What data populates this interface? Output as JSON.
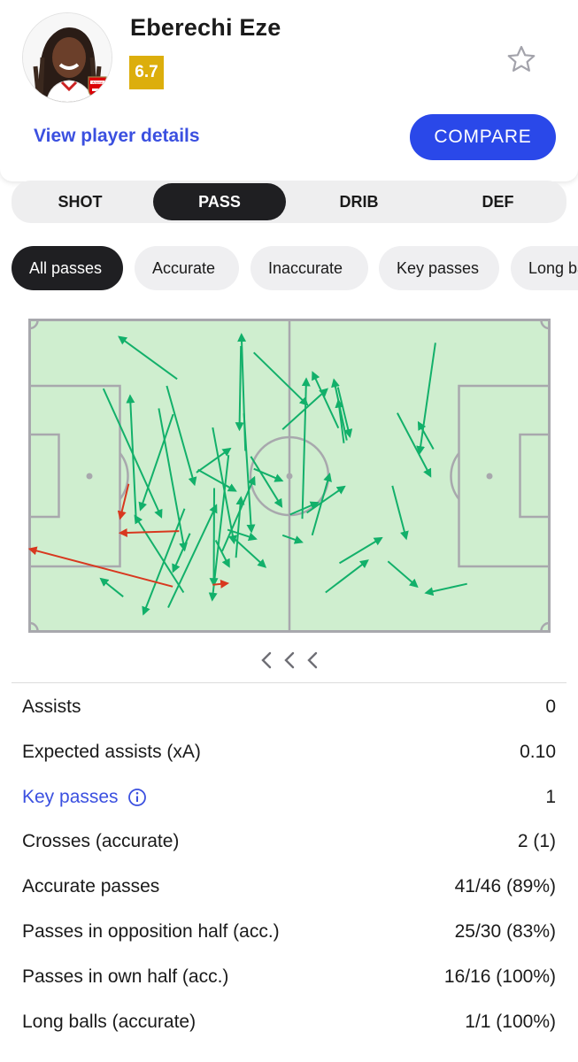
{
  "player": {
    "name": "Eberechi Eze",
    "rating": "6.7",
    "club_badge_text": "Arsenal",
    "details_link": "View player details",
    "compare_button": "COMPARE"
  },
  "colors": {
    "rating": "#dcae0c",
    "accent_blue": "#2a48e9",
    "link_blue": "#3b50e0",
    "pitch_green": "#cfeecf",
    "pass_success": "#12b06a",
    "pass_fail": "#d8381f"
  },
  "tabs": [
    {
      "label": "SHOT",
      "active": false
    },
    {
      "label": "PASS",
      "active": true
    },
    {
      "label": "DRIB",
      "active": false
    },
    {
      "label": "DEF",
      "active": false
    }
  ],
  "filters": [
    {
      "label": "All passes",
      "active": true
    },
    {
      "label": "Accurate",
      "active": false
    },
    {
      "label": "Inaccurate",
      "active": false
    },
    {
      "label": "Key passes",
      "active": false
    },
    {
      "label": "Long balls",
      "active": false
    }
  ],
  "icons": {
    "favorite": "star-outline-icon",
    "info": "info-circle-icon",
    "pager": "chevron-left-icon"
  },
  "pass_map": {
    "field_length": 105,
    "field_width": 68,
    "attack_direction": "right",
    "accurate": [
      [
        31.1,
        59.5,
        21.3,
        42.8
      ],
      [
        18.9,
        60.4,
        14.4,
        56.5
      ],
      [
        14.9,
        15.0,
        26.6,
        43.0
      ],
      [
        31.3,
        41.2,
        23.0,
        64.2
      ],
      [
        38.9,
        50.5,
        45.4,
        34.4
      ],
      [
        21.5,
        43.5,
        20.3,
        16.6
      ],
      [
        27.7,
        14.4,
        33.3,
        35.9
      ],
      [
        29.8,
        12.9,
        18.1,
        3.7
      ],
      [
        41.7,
        51.9,
        42.7,
        38.8
      ],
      [
        26.1,
        19.3,
        31.3,
        50.2
      ],
      [
        41.3,
        47.7,
        47.6,
        53.9
      ],
      [
        40.0,
        45.8,
        45.7,
        47.8
      ],
      [
        44.7,
        29.8,
        50.9,
        40.7
      ],
      [
        33.7,
        33.3,
        40.5,
        28.1
      ],
      [
        42.7,
        5.7,
        42.4,
        23.9
      ],
      [
        34.0,
        32.7,
        41.6,
        37.3
      ],
      [
        32.4,
        46.6,
        29.0,
        54.9
      ],
      [
        29.0,
        20.6,
        22.4,
        41.4
      ],
      [
        28.0,
        62.8,
        37.7,
        40.5
      ],
      [
        37.0,
        23.5,
        41.3,
        48.6
      ],
      [
        37.3,
        36.7,
        37.2,
        57.9
      ],
      [
        40.2,
        29.5,
        36.9,
        61.1
      ],
      [
        43.3,
        20.4,
        44.8,
        46.2
      ],
      [
        43.6,
        28.6,
        42.8,
        3.2
      ],
      [
        45.3,
        32.5,
        51.0,
        35.1
      ],
      [
        45.3,
        7.1,
        56.1,
        18.5
      ],
      [
        55.1,
        43.4,
        55.9,
        12.9
      ],
      [
        51.1,
        23.9,
        60.1,
        15.1
      ],
      [
        59.8,
        59.5,
        68.3,
        52.5
      ],
      [
        62.4,
        23.6,
        57.2,
        11.5
      ],
      [
        56.0,
        42.1,
        63.6,
        36.4
      ],
      [
        57.1,
        47.0,
        60.6,
        33.7
      ],
      [
        62.6,
        53.1,
        71.1,
        47.6
      ],
      [
        63.5,
        26.9,
        62.4,
        17.6
      ],
      [
        62.3,
        14.7,
        64.7,
        25.4
      ],
      [
        64.1,
        26.3,
        61.5,
        13.1
      ],
      [
        72.4,
        52.7,
        78.3,
        58.2
      ],
      [
        74.3,
        20.3,
        81.0,
        34.1
      ],
      [
        81.6,
        28.2,
        78.6,
        22.4
      ],
      [
        73.3,
        36.2,
        76.1,
        47.7
      ],
      [
        88.4,
        57.6,
        80.1,
        59.6
      ],
      [
        52.6,
        42.5,
        58.2,
        39.9
      ],
      [
        37.6,
        48.1,
        40.3,
        53.8
      ],
      [
        51.1,
        47.0,
        55.0,
        48.5
      ],
      [
        82.0,
        5.0,
        78.8,
        29.1
      ]
    ],
    "inaccurate": [
      [
        30.2,
        46.1,
        18.3,
        46.5
      ],
      [
        28.9,
        58.2,
        0.0,
        50.0
      ],
      [
        20.0,
        35.8,
        18.3,
        43.3
      ],
      [
        37.0,
        57.8,
        40.0,
        57.5
      ]
    ]
  },
  "stats": [
    {
      "label": "Assists",
      "value": "0",
      "link": false
    },
    {
      "label": "Expected assists (xA)",
      "value": "0.10",
      "link": false
    },
    {
      "label": "Key passes",
      "value": "1",
      "link": true
    },
    {
      "label": "Crosses (accurate)",
      "value": "2 (1)",
      "link": false
    },
    {
      "label": "Accurate passes",
      "value": "41/46 (89%)",
      "link": false
    },
    {
      "label": "Passes in opposition half (acc.)",
      "value": "25/30 (83%)",
      "link": false
    },
    {
      "label": "Passes in own half (acc.)",
      "value": "16/16 (100%)",
      "link": false
    },
    {
      "label": "Long balls (accurate)",
      "value": "1/1 (100%)",
      "link": false
    }
  ]
}
